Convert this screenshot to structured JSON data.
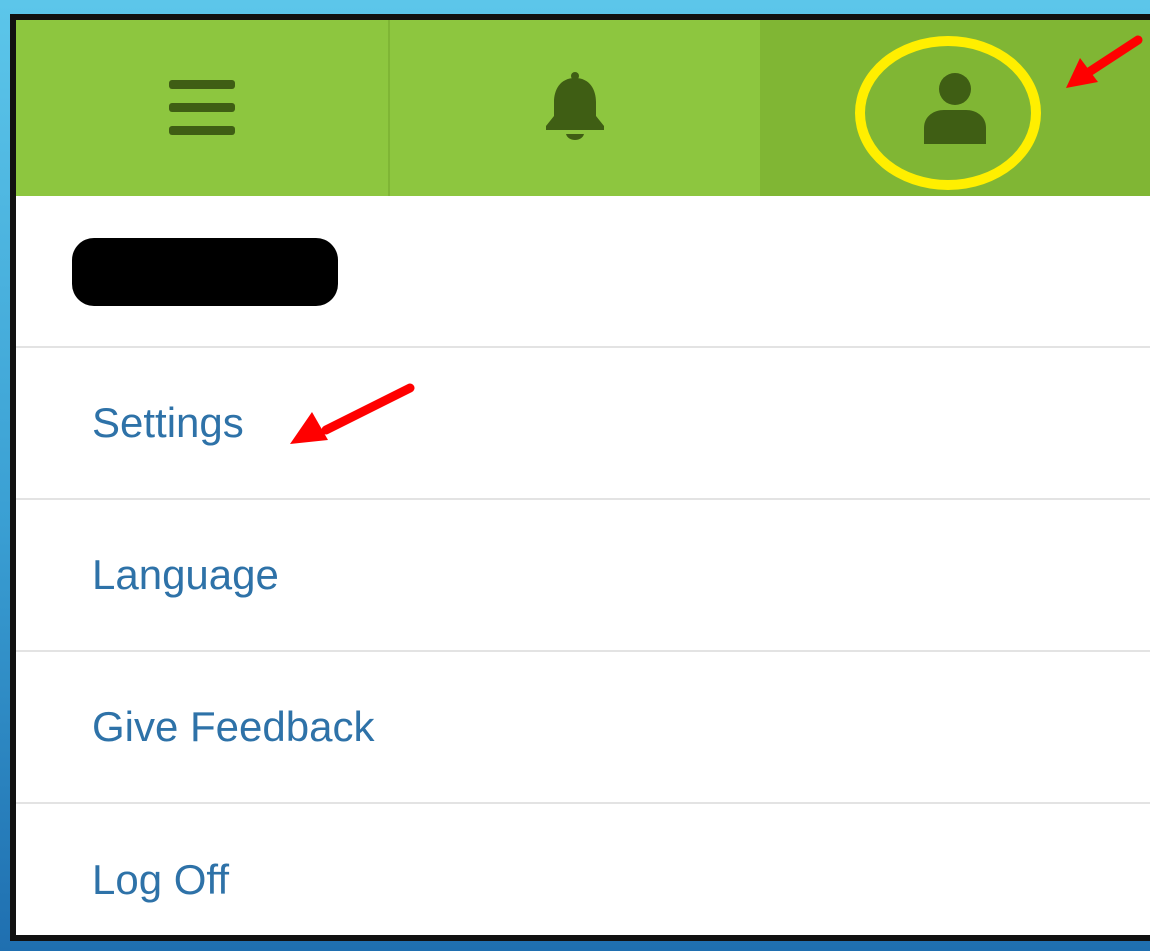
{
  "topbar": {
    "menu_icon": "hamburger-menu-icon",
    "bell_icon": "notification-bell-icon",
    "account_icon": "user-account-icon"
  },
  "account_menu": {
    "items": [
      {
        "label": "Settings"
      },
      {
        "label": "Language"
      },
      {
        "label": "Give Feedback"
      },
      {
        "label": "Log Off"
      }
    ]
  },
  "colors": {
    "topbar_green": "#8dc63f",
    "active_cell_green": "#80b634",
    "icon_dark_green": "#3f5e14",
    "link_blue": "#2e72a8",
    "highlight_yellow": "#ffef00",
    "annotation_red": "#ff0000"
  }
}
